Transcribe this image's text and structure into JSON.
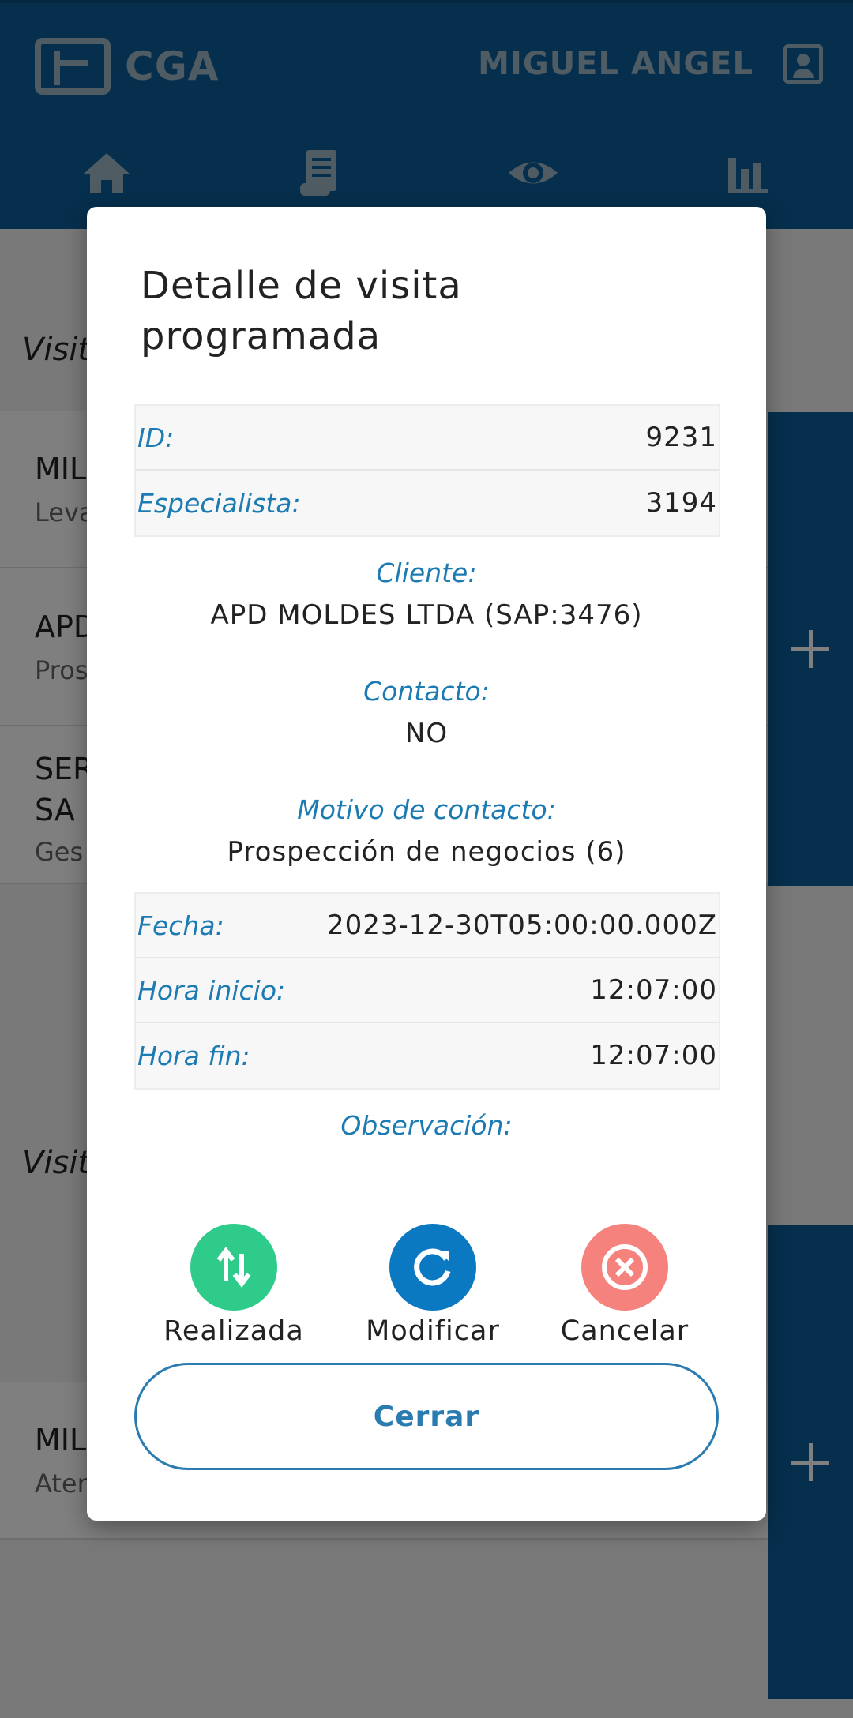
{
  "header": {
    "logo_text": "CGA",
    "user_name": "MIGUEL ANGEL",
    "nav_icons": [
      "home-icon",
      "receipt-icon",
      "eye-icon",
      "bar-chart-icon"
    ]
  },
  "background": {
    "section1_title": "Visit",
    "rows": [
      {
        "title": "MIL",
        "sub": "Leva"
      },
      {
        "title": "APD",
        "sub": "Pros"
      },
      {
        "title": "SER",
        "title2": "SA",
        "sub": "Ges"
      }
    ],
    "section2_title": "Visit",
    "rows2": [
      {
        "title": "MIL",
        "sub": "Ater"
      }
    ]
  },
  "modal": {
    "title": "Detalle de visita programada",
    "top_table": [
      {
        "label": "ID:",
        "value": "9231"
      },
      {
        "label": "Especialista:",
        "value": "3194"
      }
    ],
    "cliente": {
      "label": "Cliente:",
      "value": "APD MOLDES LTDA (SAP:3476)"
    },
    "contacto": {
      "label": "Contacto:",
      "value": "NO"
    },
    "motivo": {
      "label": "Motivo de contacto:",
      "value": "Prospección de negocios (6)"
    },
    "time_table": [
      {
        "label": "Fecha:",
        "value": "2023-12-30T05:00:00.000Z"
      },
      {
        "label": "Hora inicio:",
        "value": "12:07:00"
      },
      {
        "label": "Hora fin:",
        "value": "12:07:00"
      }
    ],
    "observacion": {
      "label": "Observación:",
      "value": ""
    },
    "actions": {
      "realizada": "Realizada",
      "modificar": "Modificar",
      "cancelar": "Cancelar"
    },
    "close_label": "Cerrar"
  },
  "colors": {
    "primary": "#0c5f9a",
    "label_blue": "#1d7bb4",
    "green": "#2fcb8b",
    "blue": "#0b78c2",
    "red": "#f6827e"
  }
}
